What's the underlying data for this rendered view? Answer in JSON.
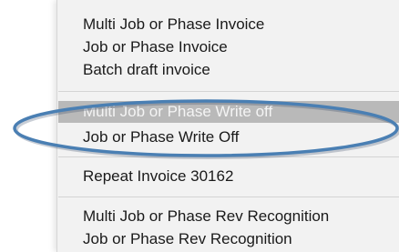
{
  "menu": {
    "groups": [
      {
        "items": [
          {
            "label": "Multi Job or Phase Invoice"
          },
          {
            "label": "Job or Phase Invoice"
          },
          {
            "label": "Batch draft invoice"
          }
        ]
      },
      {
        "items": [
          {
            "label": "Multi Job or Phase Write off",
            "highlighted": true
          },
          {
            "label": "Job or Phase Write Off"
          }
        ]
      },
      {
        "items": [
          {
            "label": "Repeat Invoice 30162"
          }
        ]
      },
      {
        "items": [
          {
            "label": "Multi Job or Phase Rev Recognition"
          },
          {
            "label": "Job or Phase Rev Recognition"
          }
        ]
      }
    ],
    "highlight_color": "#b9b9b9"
  },
  "annotation": {
    "shape": "ellipse",
    "color": "#4a7fb3"
  }
}
